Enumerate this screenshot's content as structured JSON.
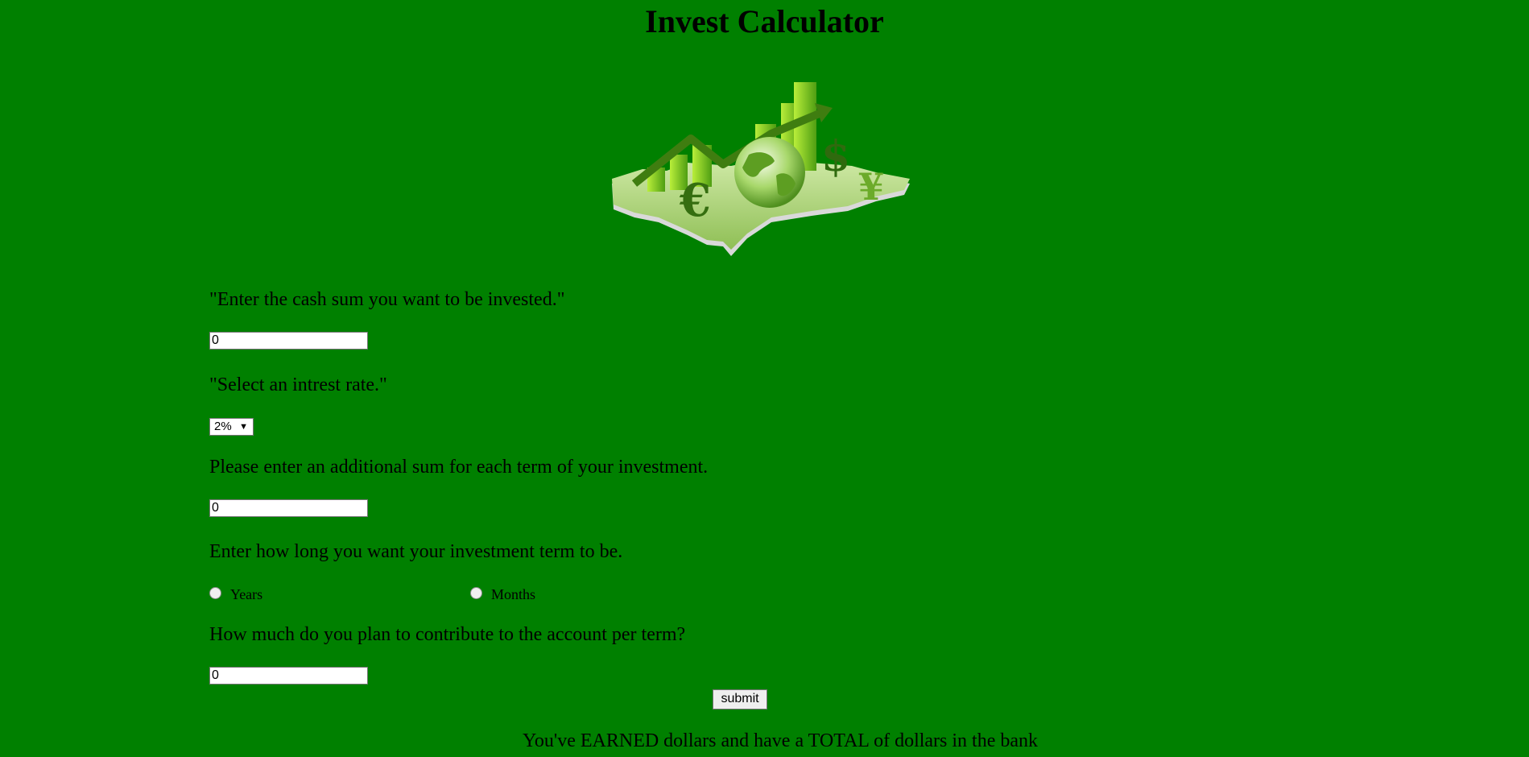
{
  "page": {
    "title": "Invest Calculator",
    "background_color": "#008000"
  },
  "hero": {
    "icon": "finance-globe-graphic-icon",
    "symbols": [
      "€",
      "$",
      "¥"
    ]
  },
  "form": {
    "cash_sum": {
      "label": "\"Enter the cash sum you want to be invested.\"",
      "value": "0"
    },
    "interest_rate": {
      "label": "\"Select an intrest rate.\"",
      "selected": "2%",
      "arrow": "▼"
    },
    "additional_sum": {
      "label": "Please enter an additional sum for each term of your investment.",
      "value": "0"
    },
    "term": {
      "label": "Enter how long you want your investment term to be.",
      "options": [
        "Years",
        "Months"
      ]
    },
    "contribution": {
      "label": "How much do you plan to contribute to the account per term?",
      "value": "0"
    },
    "submit_label": "submit"
  },
  "result": {
    "text": "You've EARNED dollars and have a TOTAL of dollars in the bank"
  }
}
